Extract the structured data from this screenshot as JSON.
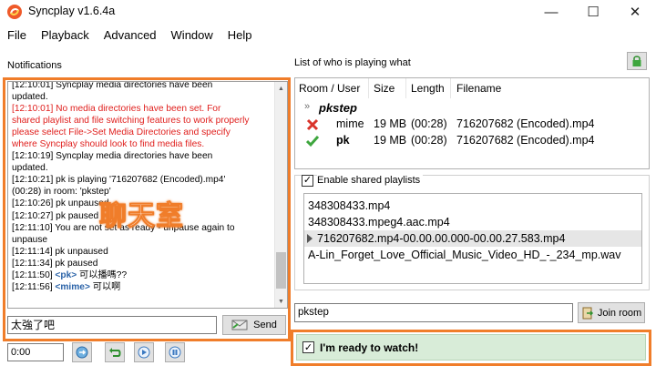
{
  "window": {
    "title": "Syncplay v1.6.4a",
    "controls": {
      "minimize": "—",
      "maximize": "☐",
      "close": "✕"
    }
  },
  "menu": [
    "File",
    "Playback",
    "Advanced",
    "Window",
    "Help"
  ],
  "notifications": {
    "label": "Notifications",
    "lines": [
      {
        "text": "[12:10:01] Syncplay media directories have been",
        "style": "normal"
      },
      {
        "text": "updated.",
        "style": "normal"
      },
      {
        "text": "[12:10:01] No media directories have been set. For",
        "style": "red"
      },
      {
        "text": "shared playlist and file switching features to work properly",
        "style": "red"
      },
      {
        "text": "please select File->Set Media Directories and specify",
        "style": "red"
      },
      {
        "text": "where Syncplay should look to find media files.",
        "style": "red"
      },
      {
        "text": "[12:10:19] Syncplay media directories have been",
        "style": "normal"
      },
      {
        "text": "updated.",
        "style": "normal"
      },
      {
        "text": "[12:10:21] pk is playing '716207682 (Encoded).mp4'",
        "style": "normal"
      },
      {
        "text": "(00:28) in room: 'pkstep'",
        "style": "normal"
      },
      {
        "text": "[12:10:26] pk unpaused",
        "style": "normal"
      },
      {
        "text": "[12:10:27] pk paused",
        "style": "normal"
      },
      {
        "text": "[12:11:10] You are not set as ready - unpause again to",
        "style": "normal"
      },
      {
        "text": "unpause",
        "style": "normal"
      },
      {
        "text": "[12:11:14] pk unpaused",
        "style": "normal"
      },
      {
        "text": "[12:11:34] pk paused",
        "style": "normal"
      }
    ],
    "chat": [
      {
        "time": "[12:11:50]",
        "who": "<pk>",
        "msg": "可以播嗎??"
      },
      {
        "time": "[12:11:56]",
        "who": "<mime>",
        "msg": "可以啊"
      }
    ],
    "overlay_label": "聊天室",
    "chat_input_value": "太強了吧",
    "send_label": "Send",
    "position_value": "0:00"
  },
  "room_list": {
    "label": "List of who is playing what",
    "columns": [
      "Room / User",
      "Size",
      "Length",
      "Filename"
    ],
    "room": "pkstep",
    "users": [
      {
        "name": "mime",
        "status": "not-ready",
        "status_icon": "x-icon",
        "size": "19 MB",
        "length": "(00:28)",
        "filename": "716207682 (Encoded).mp4"
      },
      {
        "name": "pk",
        "status": "ready",
        "status_icon": "check-icon",
        "size": "19 MB",
        "length": "(00:28)",
        "filename": "716207682 (Encoded).mp4"
      }
    ]
  },
  "shared_playlists": {
    "enabled_label": "Enable shared playlists",
    "enabled": true,
    "items": [
      {
        "name": "348308433.mp4",
        "selected": false
      },
      {
        "name": "348308433.mpeg4.aac.mp4",
        "selected": false
      },
      {
        "name": "716207682.mp4-00.00.00.000-00.00.27.583.mp4",
        "selected": true
      },
      {
        "name": "A-Lin_Forget_Love_Official_Music_Video_HD_-_234_mp.wav",
        "selected": false
      }
    ]
  },
  "room_input_value": "pkstep",
  "join_label": "Join room",
  "ready_label": "I'm ready to watch!",
  "colors": {
    "highlight_frame": "#f07d2a",
    "error_text": "#e0201e",
    "chat_name": "#2b63a8",
    "ready_bg": "#d8ecd8"
  }
}
